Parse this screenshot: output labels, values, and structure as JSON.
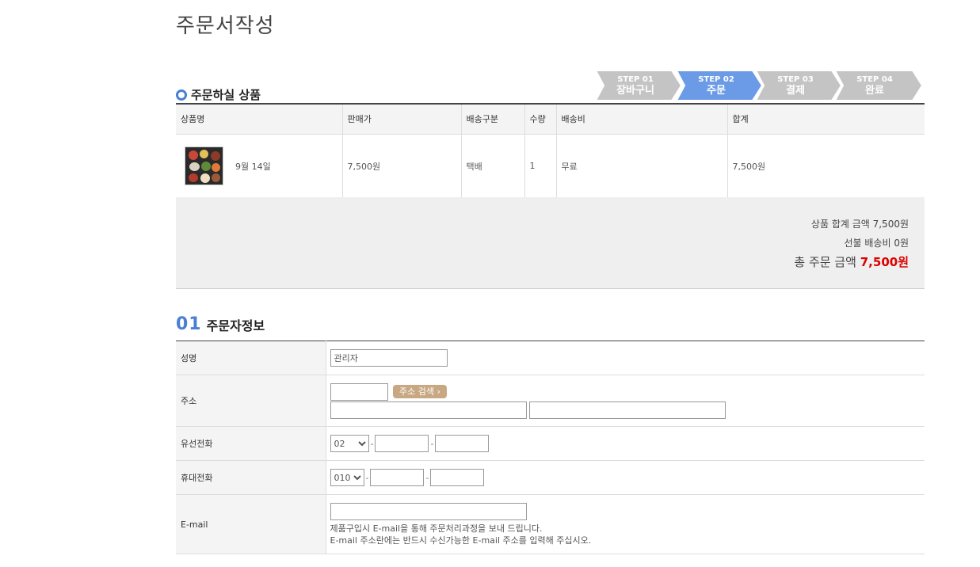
{
  "page": {
    "title": "주문서작성"
  },
  "steps": [
    {
      "num": "STEP 01",
      "label": "장바구니",
      "active": false
    },
    {
      "num": "STEP 02",
      "label": "주문",
      "active": true
    },
    {
      "num": "STEP 03",
      "label": "결제",
      "active": false
    },
    {
      "num": "STEP 04",
      "label": "완료",
      "active": false
    }
  ],
  "order_items": {
    "heading": "주문하실 상품",
    "columns": [
      "상품명",
      "판매가",
      "배송구분",
      "수량",
      "배송비",
      "합계"
    ],
    "rows": [
      {
        "name": "9월 14일",
        "price": "7,500원",
        "shipping_type": "택배",
        "qty": "1",
        "shipping_fee": "무료",
        "total": "7,500원"
      }
    ]
  },
  "summary": {
    "product_total": "상품 합계 금액 7,500원",
    "prepaid_shipping": "선불 배송비 0원",
    "grand_total_label": "총 주문 금액",
    "grand_total_value": "7,500원"
  },
  "orderer": {
    "num": "01",
    "heading": "주문자정보",
    "name_label": "성명",
    "name_value": "관리자",
    "address_label": "주소",
    "address_search_label": "주소 검색",
    "phone_label": "유선전화",
    "phone_prefix": "02",
    "mobile_label": "휴대전화",
    "mobile_prefix": "010",
    "email_label": "E-mail",
    "email_notice_1": "제품구입시 E-mail을 통해 주문처리과정을 보내 드립니다.",
    "email_notice_2": "E-mail 주소란에는 반드시 수신가능한 E-mail 주소를 입력해 주십시오."
  },
  "colors": {
    "accent": "#4a7fd4",
    "step_active": "#6b9be6",
    "step_inactive": "#c4c4c4",
    "price_red": "#dd0000",
    "address_btn": "#c7a882"
  }
}
